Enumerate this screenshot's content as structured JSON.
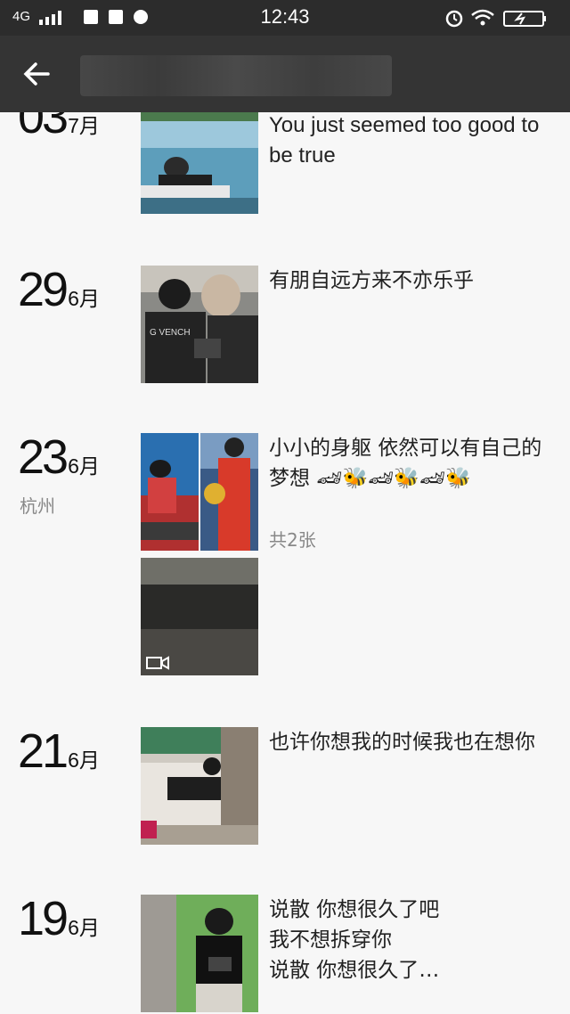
{
  "status_bar": {
    "network": "4G",
    "time": "12:43"
  },
  "header": {
    "back_icon": "arrow-left-icon"
  },
  "entries": [
    {
      "day": "03",
      "month": "7月",
      "location": "",
      "text": "When I laid my eyes on you\nYou just seemed too good to be true",
      "count": ""
    },
    {
      "day": "29",
      "month": "6月",
      "location": "",
      "text": "有朋自远方来不亦乐乎",
      "count": ""
    },
    {
      "day": "23",
      "month": "6月",
      "location": "杭州",
      "text": "小小的身躯  依然可以有自己的梦想  🏎🐝🏎🐝🏎🐝",
      "count": "共2张"
    },
    {
      "day": "21",
      "month": "6月",
      "location": "",
      "text": "也许你想我的时候我也在想你",
      "count": ""
    },
    {
      "day": "19",
      "month": "6月",
      "location": "",
      "text": "说散 你想很久了吧\n我不想拆穿你\n说散 你想很久了…",
      "count": ""
    }
  ],
  "colors": {
    "status_bar_bg": "#2c2c2c",
    "header_bg": "#343434",
    "page_bg": "#f7f7f7",
    "secondary_text": "#888888"
  }
}
